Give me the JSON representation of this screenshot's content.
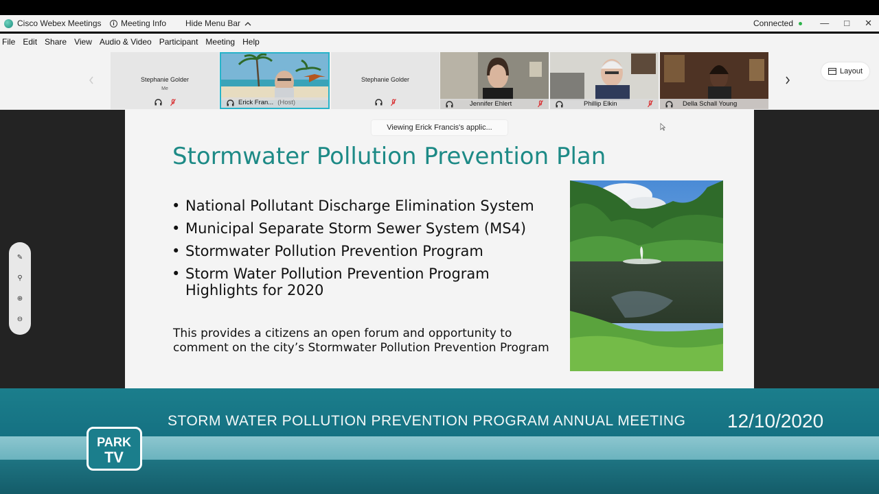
{
  "titlebar": {
    "app_name": "Cisco Webex Meetings",
    "meeting_info": "Meeting Info",
    "hide_menu": "Hide Menu Bar",
    "status": "Connected"
  },
  "menu": [
    "File",
    "Edit",
    "Share",
    "View",
    "Audio & Video",
    "Participant",
    "Meeting",
    "Help"
  ],
  "participants": [
    {
      "name": "Stephanie Golder",
      "sub": "Me"
    },
    {
      "name": "Erick Fran...",
      "role": "(Host)"
    },
    {
      "name": "Stephanie Golder"
    },
    {
      "name": "Jennifer Ehlert"
    },
    {
      "name": "Phillip Elkin"
    },
    {
      "name": "Della Schall Young"
    }
  ],
  "layout_button": "Layout",
  "viewing_banner": "Viewing Erick Francis's applic...",
  "slide": {
    "title": "Stormwater Pollution Prevention Plan",
    "bullets": [
      "National Pollutant Discharge Elimination System",
      "Municipal Separate Storm Sewer System (MS4)",
      "Stormwater Pollution Prevention Program",
      "Storm Water Pollution Prevention Program Highlights for 2020"
    ],
    "note": "This provides a citizens an open forum and opportunity to comment on the city’s Stormwater Pollution Prevention Program"
  },
  "broadcast": {
    "headline": "STORM WATER POLLUTION PREVENTION PROGRAM ANNUAL MEETING",
    "date": "12/10/2020",
    "logo_text": "PARK TV"
  },
  "colors": {
    "slide_title": "#1d8a86",
    "host_border": "#27b3c9",
    "connected_dot": "#2db34a",
    "lower_third": "#1b7e8c"
  }
}
